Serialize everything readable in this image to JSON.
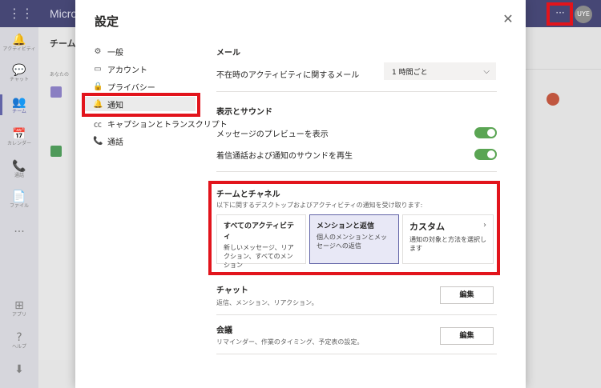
{
  "app": {
    "title": "Micro",
    "avatar_initials": "UYE",
    "more_label": "···",
    "rail": [
      {
        "icon": "bell-icon",
        "glyph": "🔔",
        "label": "アクティビティ"
      },
      {
        "icon": "chat-icon",
        "glyph": "💬",
        "label": "チャット"
      },
      {
        "icon": "teams-icon",
        "glyph": "👥",
        "label": "チーム"
      },
      {
        "icon": "calendar-icon",
        "glyph": "📅",
        "label": "カレンダー"
      },
      {
        "icon": "phone-icon",
        "glyph": "📞",
        "label": "通話"
      },
      {
        "icon": "file-icon",
        "glyph": "📄",
        "label": "ファイル"
      },
      {
        "icon": "more-icon",
        "glyph": "···",
        "label": ""
      },
      {
        "icon": "apps-icon",
        "glyph": "⊞",
        "label": "アプリ"
      },
      {
        "icon": "help-icon",
        "glyph": "?",
        "label": "ヘルプ"
      },
      {
        "icon": "download-icon",
        "glyph": "⬇",
        "label": ""
      }
    ],
    "teams_header": "チーム",
    "teams_sub": "あなたの"
  },
  "settings": {
    "title": "設定",
    "close_glyph": "✕",
    "nav": [
      {
        "icon": "gear-icon",
        "glyph": "⚙",
        "label": "一般"
      },
      {
        "icon": "id-card-icon",
        "glyph": "▭",
        "label": "アカウント"
      },
      {
        "icon": "lock-icon",
        "glyph": "🔒",
        "label": "プライバシー"
      },
      {
        "icon": "bell-icon",
        "glyph": "🔔",
        "label": "通知"
      },
      {
        "icon": "cc-icon",
        "glyph": "㏄",
        "label": "キャプションとトランスクリプト"
      },
      {
        "icon": "phone-icon",
        "glyph": "📞",
        "label": "通話"
      }
    ],
    "mail": {
      "title": "メール",
      "label": "不在時のアクティビティに関するメール",
      "value": "1 時間ごと"
    },
    "display": {
      "title": "表示とサウンド",
      "preview_label": "メッセージのプレビューを表示",
      "sound_label": "着信通話および通知のサウンドを再生",
      "preview_on": true,
      "sound_on": true
    },
    "teams_channels": {
      "title": "チームとチャネル",
      "desc": "以下に関するデスクトップおよびアクティビティの通知を受け取ります:",
      "options": [
        {
          "title": "すべてのアクティビティ",
          "desc": "新しいメッセージ、リアクション、すべてのメンション"
        },
        {
          "title": "メンションと返信",
          "desc": "個人のメンションとメッセージへの返信"
        },
        {
          "title": "カスタム",
          "desc": "通知の対象と方法を選択します"
        }
      ]
    },
    "chat": {
      "title": "チャット",
      "desc": "返信、メンション、リアクション。",
      "button": "編集"
    },
    "meeting": {
      "title": "会議",
      "desc": "リマインダー、作業のタイミング、予定表の設定。",
      "button": "編集"
    }
  },
  "colors": {
    "highlight": "#e2141c",
    "toggle_on": "#5aa553",
    "brand": "#6264a7"
  }
}
